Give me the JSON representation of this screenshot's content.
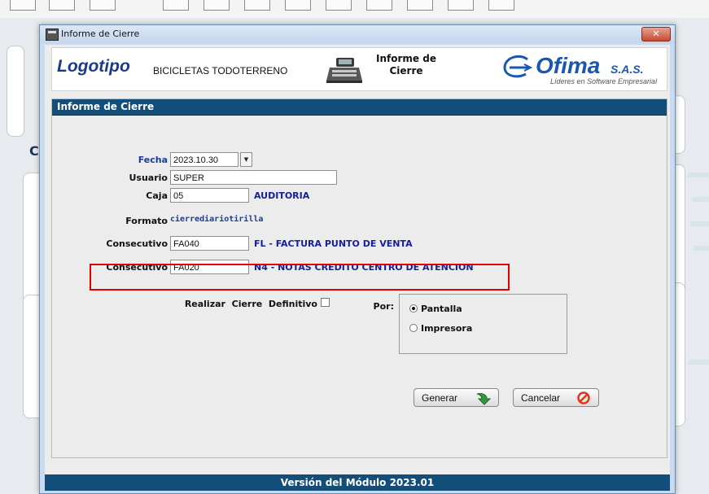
{
  "window": {
    "title": "Informe de Cierre",
    "close_glyph": "✕"
  },
  "header": {
    "logo": "Logotipo",
    "company": "BICICLETAS TODOTERRENO",
    "report_title_line1": "Informe de",
    "report_title_line2": "Cierre",
    "brand_word": "Ofima",
    "brand_suffix": "S.A.S.",
    "brand_tagline": "Líderes en Software Empresarial"
  },
  "panel": {
    "title": "Informe de Cierre"
  },
  "form": {
    "fecha_label": "Fecha",
    "fecha_value": "2023.10.30",
    "usuario_label": "Usuario",
    "usuario_value": "SUPER",
    "caja_label": "Caja",
    "caja_value": "05",
    "caja_desc": "AUDITORIA",
    "formato_label": "Formato",
    "formato_value": "cierrediariotirilla",
    "consecutivo1_label": "Consecutivo",
    "consecutivo1_value": "FA040",
    "consecutivo1_desc": "FL - FACTURA PUNTO DE VENTA",
    "consecutivo2_label": "Consecutivo",
    "consecutivo2_value": "FA020",
    "consecutivo2_desc": "N4 - NOTAS CREDITO CENTRO DE ATENCION",
    "cierre_label": "Realizar  Cierre  Definitivo",
    "cierre_checked": false,
    "por_label": "Por:",
    "por_options": [
      "Pantalla",
      "Impresora"
    ],
    "por_selected": "Pantalla"
  },
  "buttons": {
    "generar": "Generar",
    "cancelar": "Cancelar"
  },
  "footer": {
    "version": "Versión del Módulo 2023.01"
  },
  "background": {
    "letter": "C"
  },
  "colors": {
    "header_blue": "#134d7a",
    "label_blue": "#1a3c9c",
    "highlight_red": "#e00000",
    "generar_arrow": "#2e9a3e",
    "cancelar_icon": "#e0361c"
  },
  "icons": [
    "window-app-icon",
    "close-icon",
    "cash-register-icon",
    "ofima-logo-icon",
    "dropdown-arrow-icon",
    "green-arrow-icon",
    "cancel-circle-icon"
  ]
}
